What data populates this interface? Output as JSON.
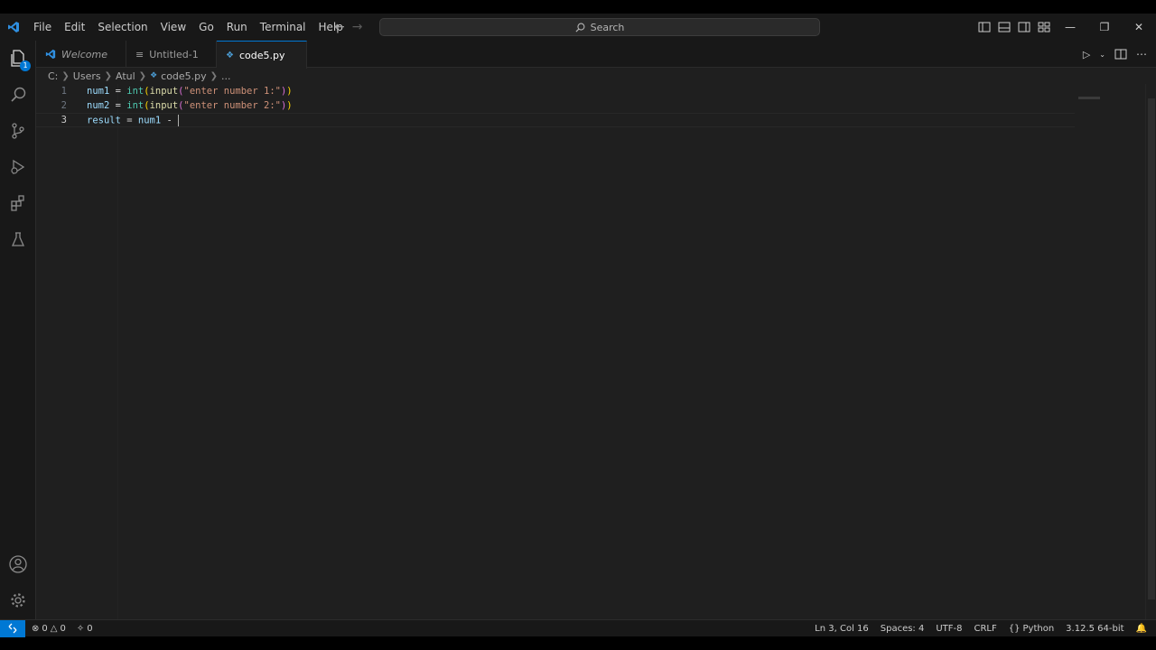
{
  "menu": [
    "File",
    "Edit",
    "Selection",
    "View",
    "Go",
    "Run",
    "Terminal",
    "Help"
  ],
  "search": {
    "label": "Search"
  },
  "activity": {
    "explorer_badge": "1"
  },
  "tabs": [
    {
      "label": "Welcome"
    },
    {
      "label": "Untitled-1"
    },
    {
      "label": "code5.py"
    }
  ],
  "breadcrumb": [
    "C:",
    "Users",
    "Atul",
    "code5.py",
    "..."
  ],
  "editor": {
    "line_numbers": [
      "1",
      "2",
      "3"
    ],
    "lines": [
      {
        "var": "num1",
        "op": " = ",
        "fn": "int",
        "b1o": "(",
        "call": "input",
        "b2o": "(",
        "str": "\"enter number 1:\"",
        "b2c": ")",
        "b1c": ")"
      },
      {
        "var": "num2",
        "op": " = ",
        "fn": "int",
        "b1o": "(",
        "call": "input",
        "b2o": "(",
        "str": "\"enter number 2:\"",
        "b2c": ")",
        "b1c": ")"
      },
      {
        "var": "result",
        "op": " = ",
        "var2": "num1",
        "op2": " - "
      }
    ]
  },
  "status": {
    "errors": "0",
    "warnings": "0",
    "ports": "0",
    "position": "Ln 3, Col 16",
    "spaces": "Spaces: 4",
    "encoding": "UTF-8",
    "eol": "CRLF",
    "language": "Python",
    "interpreter": "3.12.5 64-bit"
  },
  "colors": {
    "accent": "#0078d4",
    "background": "#1f1f1f",
    "chrome": "#181818"
  }
}
